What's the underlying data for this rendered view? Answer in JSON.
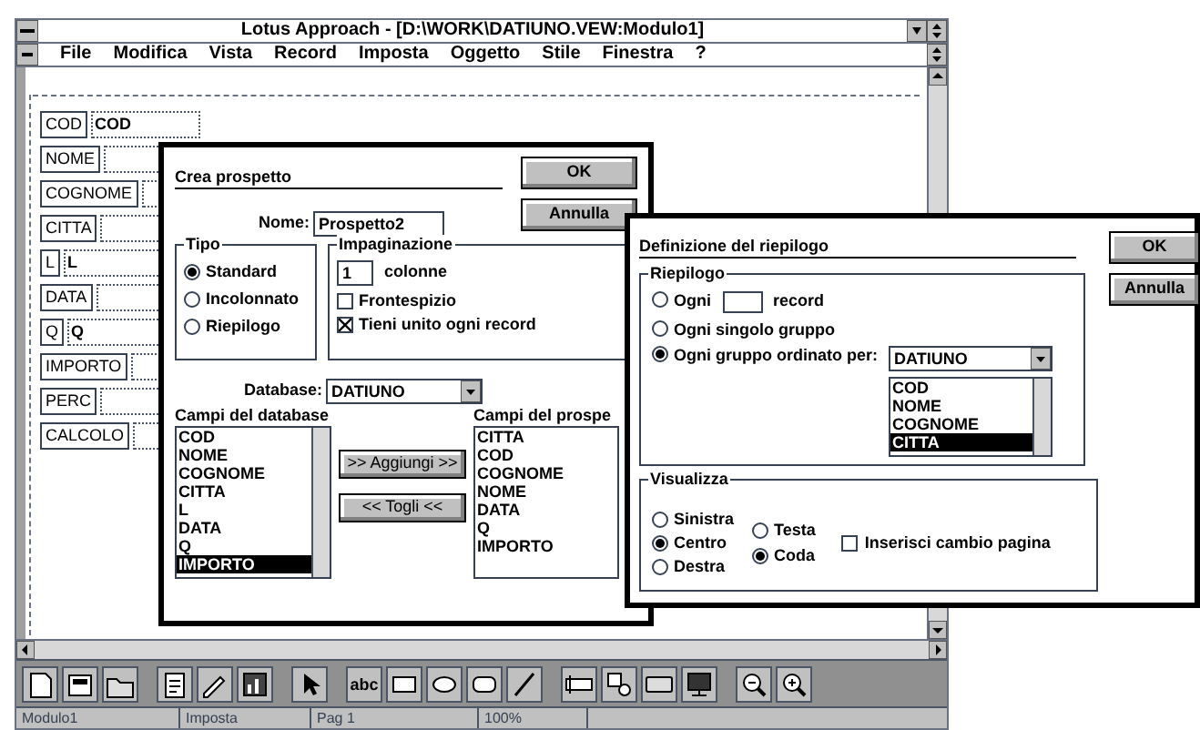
{
  "window": {
    "title": "Lotus Approach - [D:\\WORK\\DATIUNO.VEW:Modulo1]"
  },
  "menu": [
    "File",
    "Modifica",
    "Vista",
    "Record",
    "Imposta",
    "Oggetto",
    "Stile",
    "Finestra",
    "?"
  ],
  "form_fields": [
    {
      "label": "COD",
      "value": "COD"
    },
    {
      "label": "NOME"
    },
    {
      "label": "COGNOME"
    },
    {
      "label": "CITTA"
    },
    {
      "label": "L",
      "value": "L"
    },
    {
      "label": "DATA"
    },
    {
      "label": "Q",
      "value": "Q"
    },
    {
      "label": "IMPORTO"
    },
    {
      "label": "PERC"
    },
    {
      "label": "CALCOLO"
    }
  ],
  "create_dialog": {
    "title": "Crea prospetto",
    "buttons": [
      "OK",
      "Annulla"
    ],
    "name_label": "Nome:",
    "name_value": "Prospetto2",
    "type_group": {
      "title": "Tipo",
      "options": [
        {
          "label": "Standard",
          "selected": true
        },
        {
          "label": "Incolonnato",
          "selected": false
        },
        {
          "label": "Riepilogo",
          "selected": false
        }
      ]
    },
    "layout_group": {
      "title": "Impaginazione",
      "columns_value": "1",
      "columns_label": "colonne",
      "checkboxes": [
        {
          "label": "Frontespizio",
          "checked": false
        },
        {
          "label": "Tieni unito ogni record",
          "checked": true
        }
      ]
    },
    "database_label": "Database:",
    "database_value": "DATIUNO",
    "database_fields": {
      "title": "Campi del database",
      "items": [
        {
          "label": "COD",
          "selected": false
        },
        {
          "label": "NOME",
          "selected": false
        },
        {
          "label": "COGNOME",
          "selected": false
        },
        {
          "label": "CITTA",
          "selected": false
        },
        {
          "label": "L",
          "selected": false
        },
        {
          "label": "DATA",
          "selected": false
        },
        {
          "label": "Q",
          "selected": false
        },
        {
          "label": "IMPORTO",
          "selected": true
        }
      ]
    },
    "move_buttons": [
      ">> Aggiungi >>",
      "<< Togli <<"
    ],
    "report_fields": {
      "title": "Campi del prospe",
      "items": [
        "CITTA",
        "COD",
        "COGNOME",
        "NOME",
        "DATA",
        "Q",
        "IMPORTO"
      ]
    }
  },
  "summary_dialog": {
    "title": "Definizione del riepilogo",
    "buttons": [
      "OK",
      "Annulla"
    ],
    "summary_group": {
      "title": "Riepilogo",
      "options": [
        {
          "kind": "count",
          "label": "Ogni",
          "suffix": "record",
          "selected": false
        },
        {
          "kind": "plain",
          "label": "Ogni singolo gruppo",
          "selected": false
        },
        {
          "kind": "sorted",
          "label": "Ogni gruppo ordinato per:",
          "selected": true
        }
      ]
    },
    "sort_dropdown": "DATIUNO",
    "sort_fields": [
      {
        "label": "COD",
        "selected": false
      },
      {
        "label": "NOME",
        "selected": false
      },
      {
        "label": "COGNOME",
        "selected": false
      },
      {
        "label": "CITTA",
        "selected": true
      }
    ],
    "display_group": {
      "title": "Visualizza",
      "alignment": [
        {
          "label": "Sinistra",
          "selected": false
        },
        {
          "label": "Centro",
          "selected": true
        },
        {
          "label": "Destra",
          "selected": false
        }
      ],
      "position": [
        {
          "label": "Testa",
          "selected": false
        },
        {
          "label": "Coda",
          "selected": true
        }
      ],
      "page_break": {
        "label": "Inserisci cambio pagina",
        "checked": false
      }
    }
  },
  "toolbar": [
    {
      "kind": "new"
    },
    {
      "kind": "page"
    },
    {
      "kind": "folder"
    },
    {
      "kind": "sep"
    },
    {
      "kind": "form"
    },
    {
      "kind": "pencil"
    },
    {
      "kind": "chart"
    },
    {
      "kind": "sep"
    },
    {
      "kind": "pointer"
    },
    {
      "kind": "sep"
    },
    {
      "kind": "text",
      "label": "abc"
    },
    {
      "kind": "rect"
    },
    {
      "kind": "ellipse"
    },
    {
      "kind": "rounded"
    },
    {
      "kind": "line"
    },
    {
      "kind": "sep"
    },
    {
      "kind": "field"
    },
    {
      "kind": "checkbox"
    },
    {
      "kind": "button"
    },
    {
      "kind": "screen"
    },
    {
      "kind": "sep"
    },
    {
      "kind": "zoom-out"
    },
    {
      "kind": "zoom-in"
    }
  ],
  "status_bar": [
    "Modulo1",
    "Imposta",
    "Pag 1",
    "100%"
  ]
}
